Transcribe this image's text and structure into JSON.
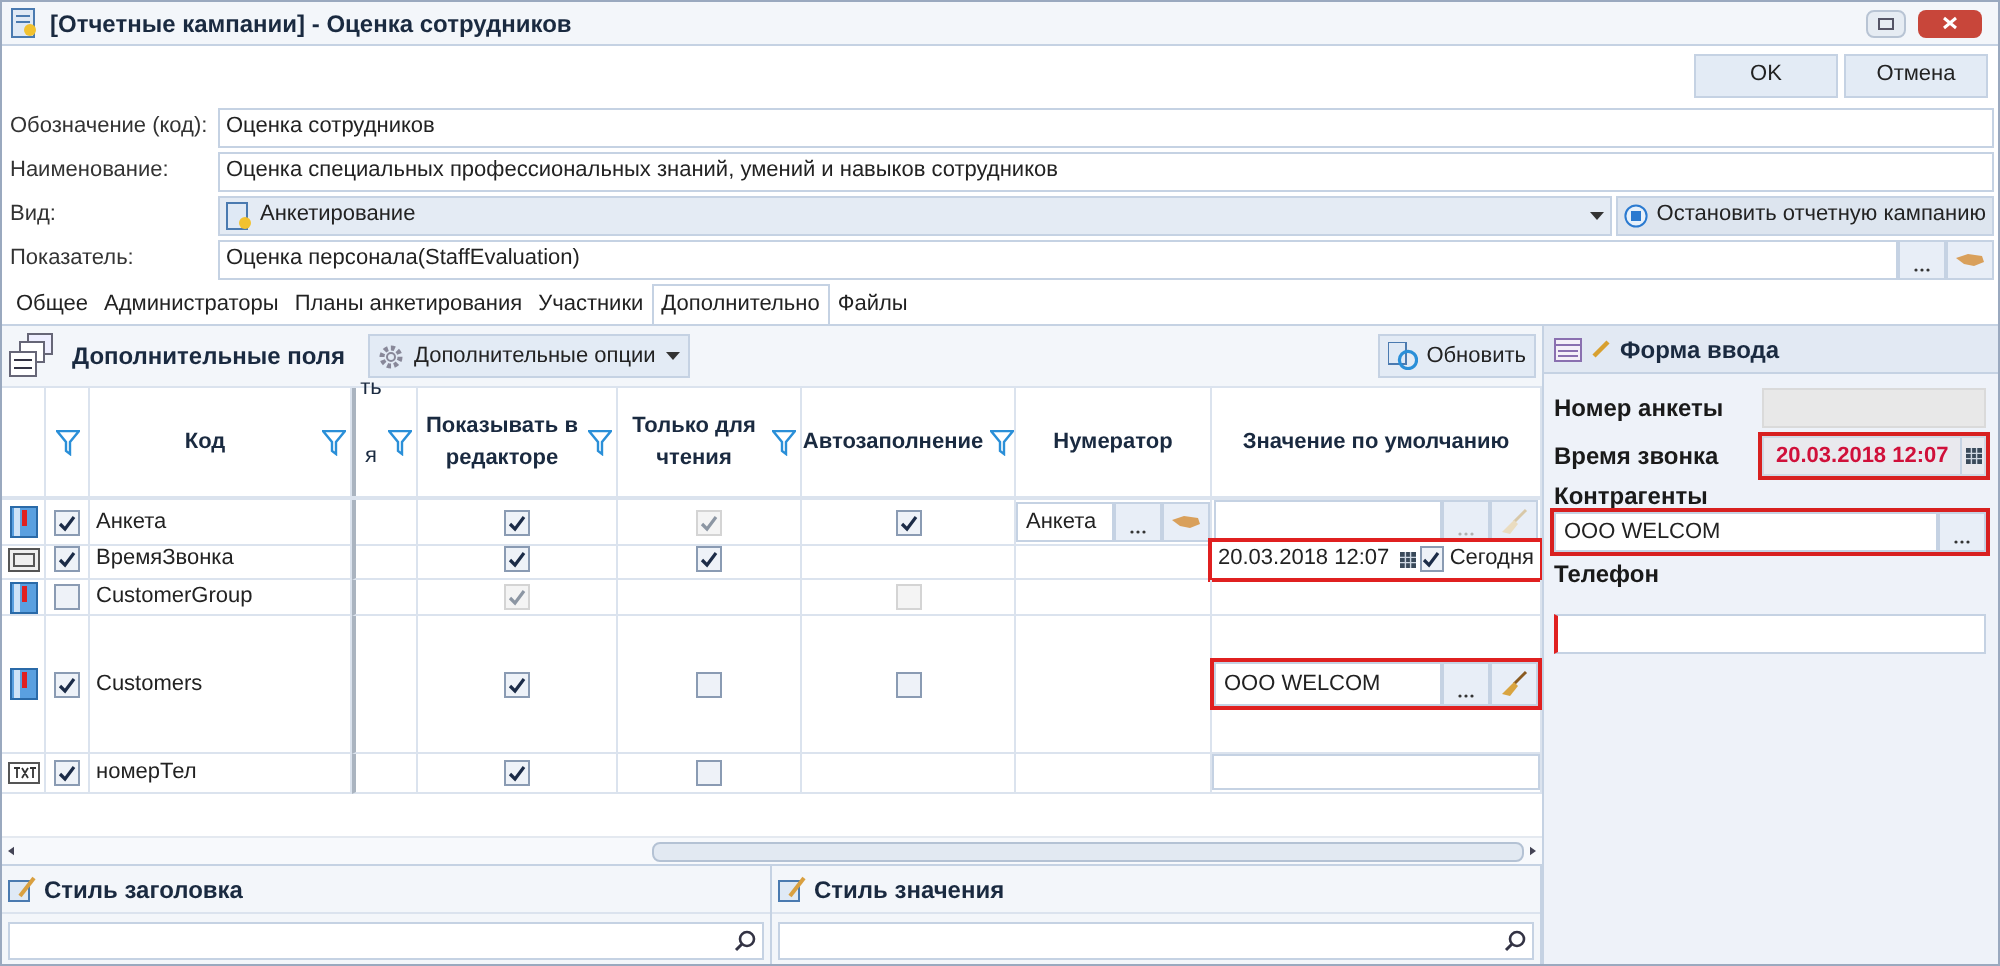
{
  "window": {
    "title": "[Отчетные кампании] - Оценка сотрудников"
  },
  "buttons": [
    {
      "label": "OK"
    },
    {
      "label": "Отмена"
    }
  ],
  "fields": [
    {
      "kind": "text",
      "label": "Обозначение (код):",
      "value": "Оценка сотрудников"
    },
    {
      "kind": "text",
      "label": "Наименование:",
      "value": "Оценка специальных профессиональных знаний, умений и навыков сотрудников"
    },
    {
      "kind": "combo",
      "label": "Вид:",
      "value": "Анкетирование",
      "action": "Остановить отчетную кампанию"
    },
    {
      "kind": "lookup",
      "label": "Показатель:",
      "value": "Оценка персонала(StaffEvaluation)"
    }
  ],
  "tabs": [
    {
      "label": "Общее",
      "selected": false
    },
    {
      "label": "Администраторы",
      "selected": false
    },
    {
      "label": "Планы анкетирования",
      "selected": false
    },
    {
      "label": "Участники",
      "selected": false
    },
    {
      "label": "Дополнительно",
      "selected": true
    },
    {
      "label": "Файлы",
      "selected": false
    }
  ],
  "toolbar": {
    "title": "Дополнительные поля",
    "options": "Дополнительные опции",
    "refresh": "Обновить"
  },
  "table": {
    "columns": [
      "Код",
      "ть я",
      "Показывать в редакторе",
      "Только для чтения",
      "Автозаполнение",
      "Нумератор",
      "Значение по умолчанию"
    ],
    "rows": [
      {
        "kind": "list",
        "checked": true,
        "code": "Анкета",
        "show": {
          "checked": true,
          "disabled": false
        },
        "readonly": {
          "checked": true,
          "disabled": true
        },
        "auto": {
          "checked": true,
          "disabled": false
        },
        "numerator": "Анкета",
        "default": {
          "kind": "lookup",
          "highlighted": false,
          "disabled": true
        }
      },
      {
        "kind": "date",
        "checked": true,
        "code": "ВремяЗвонка",
        "show": {
          "checked": true,
          "disabled": false
        },
        "readonly": {
          "checked": true,
          "disabled": false
        },
        "default": {
          "kind": "date",
          "value": "20.03.2018 12:07",
          "today": "Сегодня",
          "today_checked": true,
          "highlighted": true
        }
      },
      {
        "kind": "list",
        "checked": false,
        "code": "CustomerGroup",
        "show": {
          "checked": true,
          "disabled": true
        },
        "auto": {
          "checked": false,
          "disabled": true
        }
      },
      {
        "kind": "list",
        "checked": true,
        "code": "Customers",
        "show": {
          "checked": true,
          "disabled": false
        },
        "readonly": {
          "checked": false,
          "disabled": false
        },
        "auto": {
          "checked": false,
          "disabled": false
        },
        "default": {
          "kind": "lookup",
          "value": "ООО WELCOM",
          "highlighted": true,
          "disabled": false
        }
      },
      {
        "kind": "text",
        "checked": true,
        "code": "номерТел",
        "show": {
          "checked": true,
          "disabled": false
        },
        "readonly": {
          "checked": false,
          "disabled": false
        },
        "default": {
          "kind": "text",
          "highlighted": false
        }
      }
    ]
  },
  "form": {
    "title": "Форма ввода",
    "fields": [
      {
        "kind": "readonly",
        "label": "Номер анкеты",
        "highlighted": false
      },
      {
        "kind": "date",
        "label": "Время звонка",
        "value": "20.03.2018 12:07",
        "highlighted": true
      },
      {
        "kind": "lookup",
        "label": "Контрагенты",
        "value": "ООО WELCOM",
        "highlighted": true
      },
      {
        "kind": "text",
        "label": "Телефон",
        "highlighted": false,
        "required": true
      }
    ]
  },
  "styles": [
    {
      "title": "Стиль заголовка"
    },
    {
      "title": "Стиль значения"
    }
  ]
}
